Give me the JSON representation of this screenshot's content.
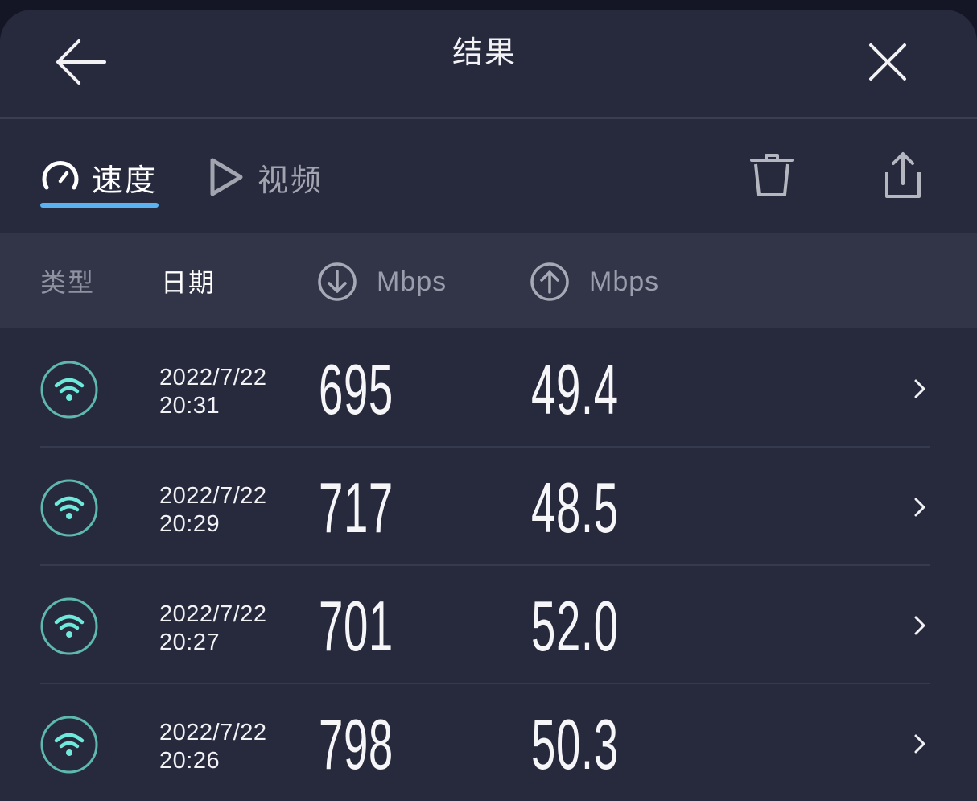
{
  "header": {
    "title": "结果",
    "back_icon": "back-arrow-icon",
    "close_icon": "close-icon"
  },
  "tabs": [
    {
      "label": "速度",
      "icon": "speedometer-icon",
      "active": true
    },
    {
      "label": "视频",
      "icon": "play-icon",
      "active": false
    }
  ],
  "toolbar": {
    "delete_icon": "trash-icon",
    "share_icon": "share-icon"
  },
  "columns": {
    "type": "类型",
    "date": "日期",
    "download_unit": "Mbps",
    "upload_unit": "Mbps",
    "download_icon": "download-arrow-icon",
    "upload_icon": "upload-arrow-icon"
  },
  "results": [
    {
      "type_icon": "wifi-icon",
      "date": "2022/7/22",
      "time": "20:31",
      "download": "695",
      "upload": "49.4"
    },
    {
      "type_icon": "wifi-icon",
      "date": "2022/7/22",
      "time": "20:29",
      "download": "717",
      "upload": "48.5"
    },
    {
      "type_icon": "wifi-icon",
      "date": "2022/7/22",
      "time": "20:27",
      "download": "701",
      "upload": "52.0"
    },
    {
      "type_icon": "wifi-icon",
      "date": "2022/7/22",
      "time": "20:26",
      "download": "798",
      "upload": "50.3"
    }
  ],
  "colors": {
    "background": "#272a3d",
    "column_band": "#323548",
    "accent": "#5bb2f0",
    "wifi_teal": "#6ee9dc"
  }
}
